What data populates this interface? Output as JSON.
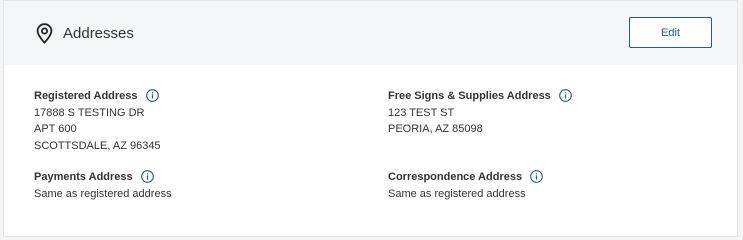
{
  "section": {
    "title": "Addresses",
    "icon": "map-pin-icon",
    "edit_label": "Edit"
  },
  "colors": {
    "accent": "#1e5f8c",
    "header_bg": "#f4f5f7",
    "text": "#333333"
  },
  "addresses": {
    "registered": {
      "label": "Registered Address",
      "lines": [
        "17888 S TESTING DR",
        "APT 600",
        "SCOTTSDALE, AZ 96345"
      ]
    },
    "signs_supplies": {
      "label": "Free Signs & Supplies Address",
      "lines": [
        "123 TEST ST",
        "PEORIA, AZ 85098"
      ]
    },
    "payments": {
      "label": "Payments Address",
      "lines": [
        "Same as registered address"
      ]
    },
    "correspondence": {
      "label": "Correspondence Address",
      "lines": [
        "Same as registered address"
      ]
    }
  }
}
